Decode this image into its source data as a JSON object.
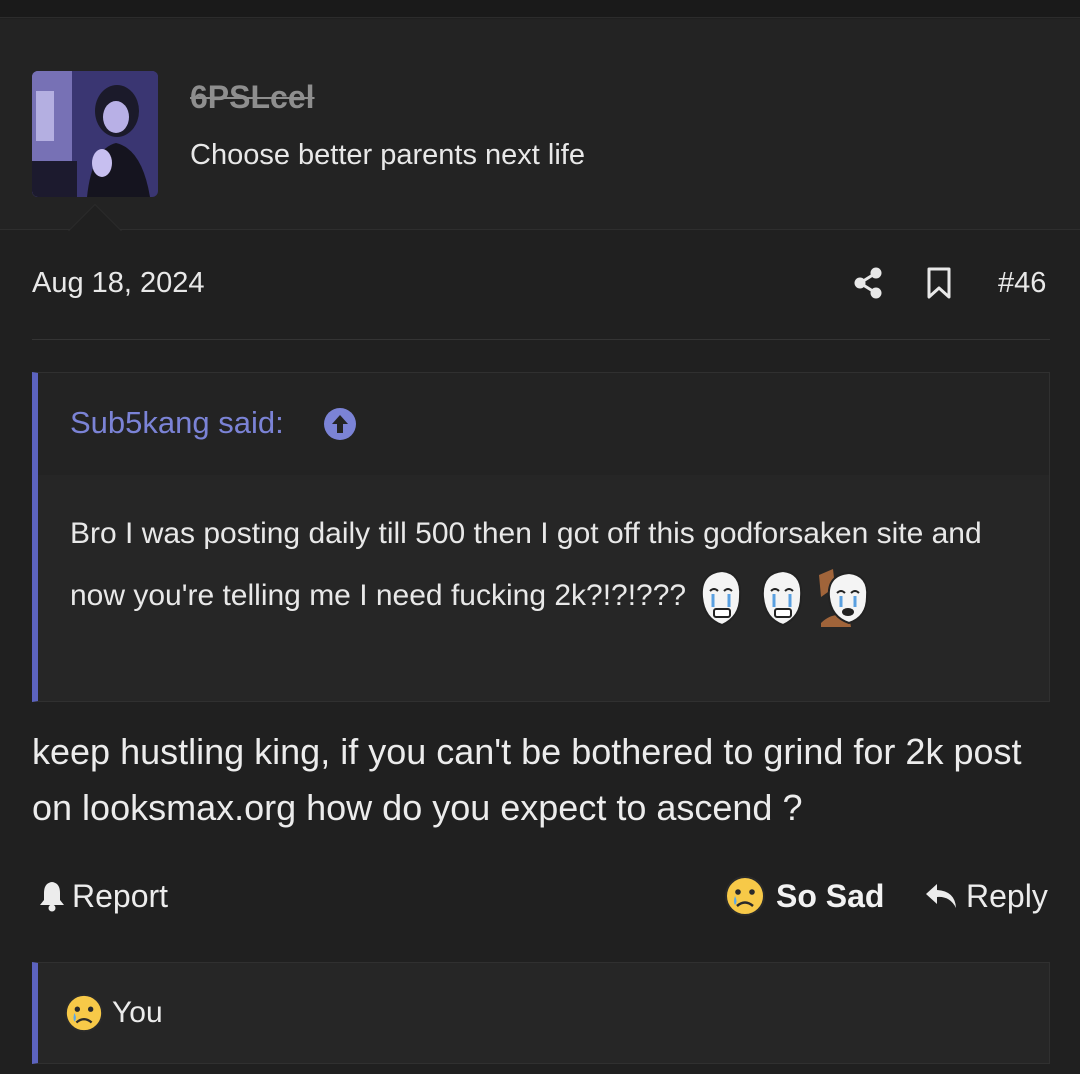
{
  "user": {
    "username": "6PSLcel",
    "title": "Choose better parents next life"
  },
  "post": {
    "date": "Aug 18, 2024",
    "number": "#46"
  },
  "quote": {
    "author": "Sub5kang said:",
    "text": "Bro I was posting daily till 500 then I got off this godforsaken site and now you're telling me I need fucking 2k?!?!???"
  },
  "reply": {
    "text": "keep hustling king, if you can't be bothered to grind for 2k post on looksmax.org how do you expect to ascend ?"
  },
  "actions": {
    "report": "Report",
    "reaction": "So Sad",
    "reply": "Reply"
  },
  "reactions": {
    "by": "You"
  },
  "colors": {
    "background": "#202020",
    "accent": "#5c63bf",
    "quote_author": "#7b83d6"
  }
}
